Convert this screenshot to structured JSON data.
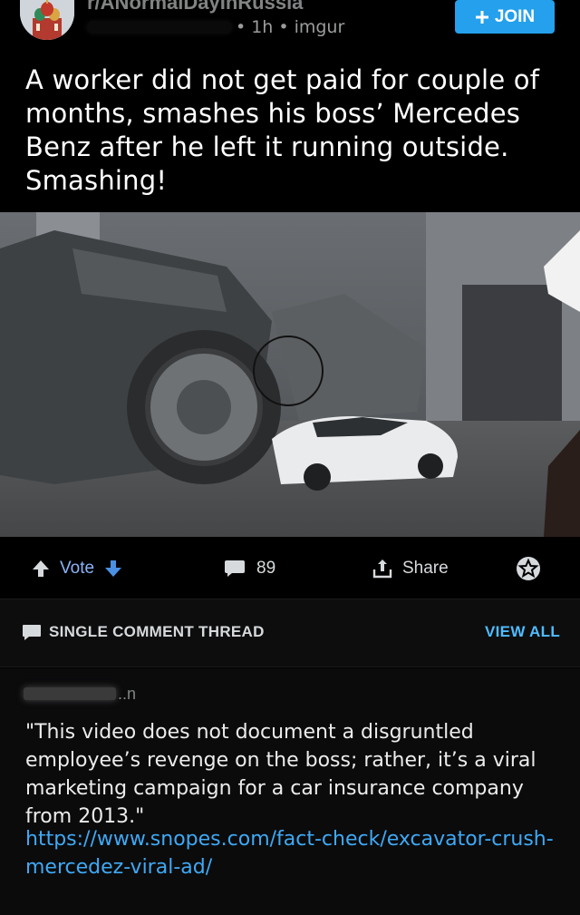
{
  "post": {
    "subreddit": "r/ANormalDayInRussia",
    "age": "1h",
    "domain": "imgur",
    "separator": "•",
    "join_label": "JOIN",
    "title": "A worker did not get paid for couple of months, smashes his boss’ Mercedes Benz after he left it running outside. Smashing!"
  },
  "actions": {
    "vote_label": "Vote",
    "comment_count": "89",
    "share_label": "Share"
  },
  "thread": {
    "label": "SINGLE COMMENT THREAD",
    "view_all": "VIEW ALL"
  },
  "comment": {
    "author_suffix": "..n",
    "body": "\"This video does not document a disgruntled employee’s revenge on the boss; rather, it’s a viral marketing campaign for a car insurance company from 2013.\"",
    "link": "https://www.snopes.com/fact-check/excavator-crush-mercedez-viral-ad/"
  },
  "colors": {
    "background": "#000000",
    "join_button": "#24a0ed",
    "link": "#3fa9f5",
    "view_all": "#4fbcff",
    "vote_arrow_down": "#4a90e2"
  },
  "icons": [
    "subreddit-avatar",
    "plus-icon",
    "upvote-icon",
    "downvote-icon",
    "comment-icon",
    "share-icon",
    "award-icon",
    "thread-comment-icon"
  ]
}
